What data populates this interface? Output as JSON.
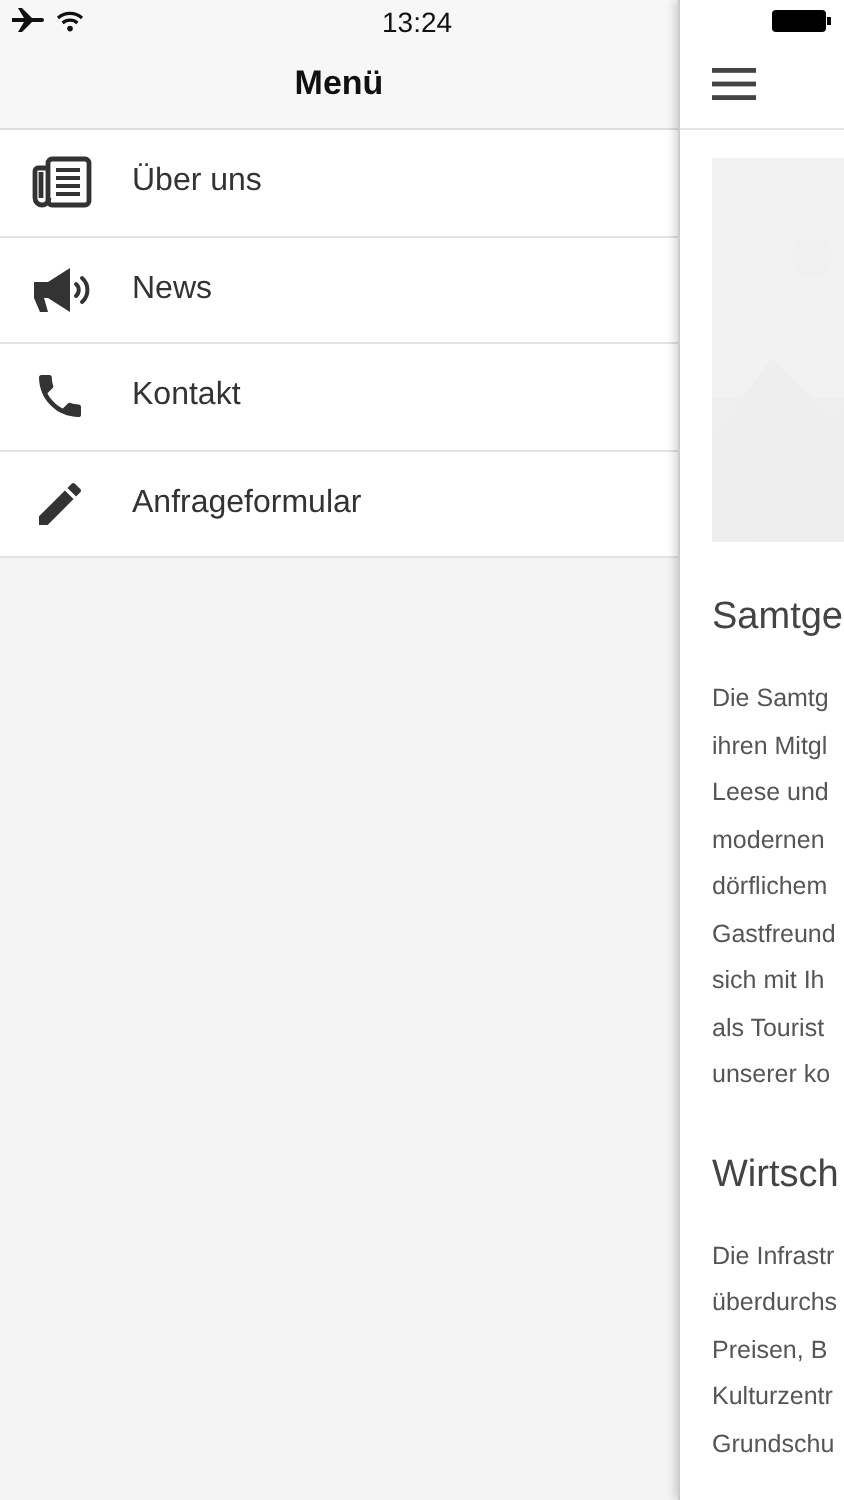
{
  "status_bar": {
    "time": "13:24"
  },
  "menu": {
    "title": "Menü",
    "items": [
      {
        "label": "Über uns",
        "kind": "newspaper"
      },
      {
        "label": "News",
        "kind": "megaphone"
      },
      {
        "label": "Kontakt",
        "kind": "phone"
      },
      {
        "label": "Anfrageformular",
        "kind": "pencil"
      }
    ]
  },
  "content": {
    "sections": [
      {
        "heading": "Samtge",
        "lines": [
          "Die Samtg",
          "ihren Mitgl",
          "Leese und",
          "modernen",
          "dörflichem",
          "Gastfreund",
          "sich mit Ih",
          "als Tourist",
          "unserer ko"
        ]
      },
      {
        "heading": "Wirtsch",
        "lines": [
          "Die Infrastr",
          "überdurchs",
          "Preisen, B",
          "Kulturzentr",
          "Grundschu"
        ]
      }
    ]
  }
}
